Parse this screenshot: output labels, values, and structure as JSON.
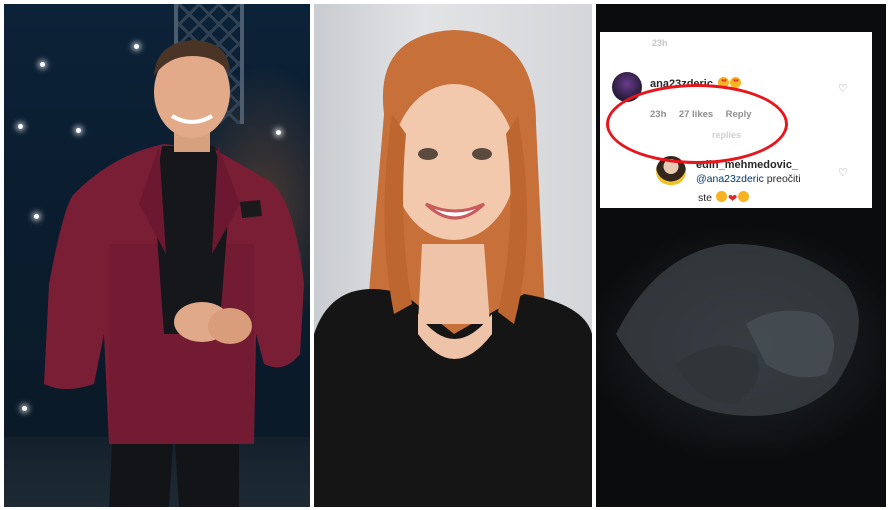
{
  "comments": {
    "top_faded": "23h",
    "first": {
      "username": "ana23zderic",
      "emojis": [
        "star-struck",
        "star-struck"
      ],
      "age": "23h",
      "likes": "27 likes",
      "reply": "Reply"
    },
    "faded_line": "replies",
    "second": {
      "username": "edin_mehmedovic_",
      "mention": "@ana23zderic",
      "text_after": "preočiti",
      "text_line2": "ste",
      "emojis": [
        "laughing-crying",
        "red-heart",
        "laughing-crying"
      ]
    }
  },
  "colors": {
    "highlight_circle": "#e8161c",
    "blazer": "#7a1e36",
    "hair": "#c7703a"
  }
}
